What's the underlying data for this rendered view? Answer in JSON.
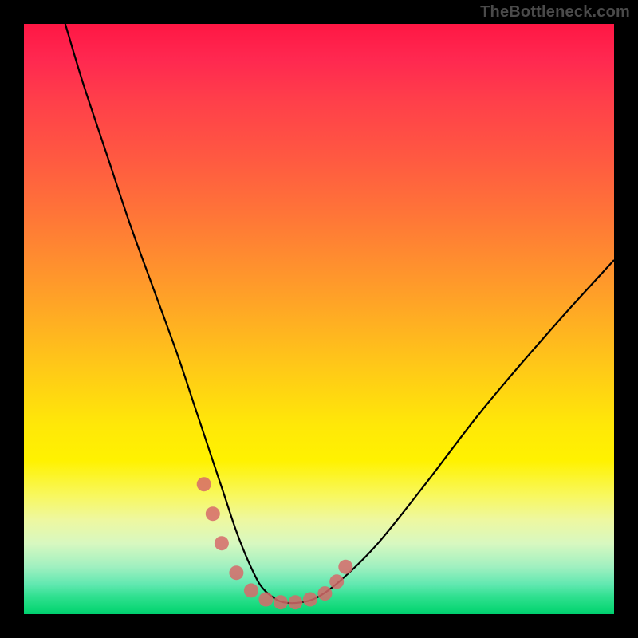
{
  "watermark": "TheBottleneck.com",
  "chart_data": {
    "type": "line",
    "title": "",
    "xlabel": "",
    "ylabel": "",
    "xlim": [
      0,
      100
    ],
    "ylim": [
      0,
      100
    ],
    "grid": false,
    "legend": false,
    "background": "vertical-gradient red→yellow→green",
    "series": [
      {
        "name": "bottleneck-curve",
        "color": "#000000",
        "x": [
          7,
          10,
          14,
          18,
          22,
          26,
          29,
          32,
          34,
          36,
          38,
          40,
          42,
          44,
          47,
          50,
          54,
          60,
          68,
          78,
          90,
          100
        ],
        "y": [
          100,
          90,
          78,
          66,
          55,
          44,
          35,
          26,
          20,
          14,
          9,
          5,
          3,
          2,
          2,
          3,
          6,
          12,
          22,
          35,
          49,
          60
        ]
      },
      {
        "name": "highlight-dots",
        "color": "#d66a6a",
        "type": "scatter",
        "x": [
          30.5,
          32.0,
          33.5,
          36.0,
          38.5,
          41.0,
          43.5,
          46.0,
          48.5,
          51.0,
          53.0,
          54.5
        ],
        "y": [
          22,
          17,
          12,
          7,
          4,
          2.5,
          2,
          2,
          2.5,
          3.5,
          5.5,
          8
        ]
      }
    ],
    "annotations": []
  }
}
